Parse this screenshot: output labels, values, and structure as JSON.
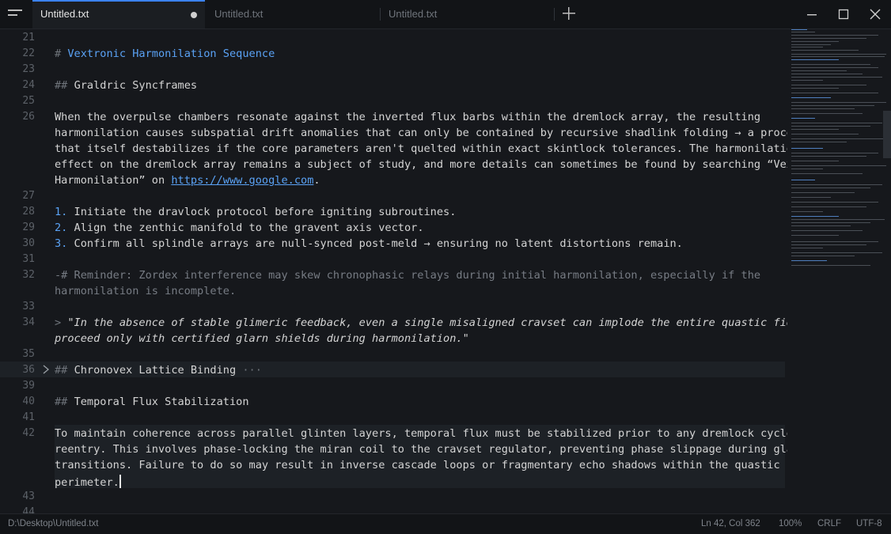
{
  "tabs": [
    {
      "label": "Untitled.txt",
      "active": true,
      "modified": true
    },
    {
      "label": "Untitled.txt",
      "active": false
    },
    {
      "label": "Untitled.txt",
      "active": false
    }
  ],
  "editor": {
    "gutter": [
      "21",
      "22",
      "23",
      "24",
      "25",
      "26",
      "27",
      "28",
      "29",
      "30",
      "31",
      "32",
      "33",
      "34",
      "35",
      "36",
      "39",
      "40",
      "41",
      "42",
      "43",
      "44"
    ],
    "h1_marker": "#",
    "h1_text": "Vextronic Harmonilation Sequence",
    "h2_marker": "##",
    "h2_graldric": "Graldric Syncframes",
    "para1": [
      "When the overpulse chambers resonate against the inverted flux barbs within the dremlock array, the resulting",
      "harmonilation causes subspatial drift anomalies that can only be contained by recursive shadlink folding → a process",
      "that itself destabilizes if the core parameters aren't quelted within exact skintlock tolerances. The harmonilation",
      "effect on the dremlock array remains a subject of study, and more details can sometimes be found by searching “Vextronic"
    ],
    "para1_last_prefix": "Harmonilation” on ",
    "para1_link": "https://www.google.com",
    "para1_last_suffix": ".",
    "list": [
      {
        "num": "1.",
        "text": " Initiate the dravlock protocol before igniting subroutines."
      },
      {
        "num": "2.",
        "text": " Align the zenthic manifold to the gravent axis vector."
      },
      {
        "num": "3.",
        "text": " Confirm all splindle arrays are null-synced post-meld → ensuring no latent distortions remain."
      }
    ],
    "comment": [
      "-# Reminder: Zordex interference may skew chronophasic relays during initial harmonilation, especially if the",
      "harmonilation is incomplete."
    ],
    "quote_marker": ">",
    "quote": [
      " \"In the absence of stable glimeric feedback, even a single misaligned cravset can implode the entire quastic field —",
      "proceed only with certified glarn shields during harmonilation.\""
    ],
    "folded_heading": "Chronovex Lattice Binding",
    "fold_ellipsis": "···",
    "h2_temporal": "Temporal Flux Stabilization",
    "para2": [
      "To maintain coherence across parallel glinten layers, temporal flux must be stabilized prior to any dremlock cycle",
      "reentry. This involves phase-locking the miran coil to the cravset regulator, preventing phase slippage during glarn",
      "transitions. Failure to do so may result in inverse cascade loops or fragmentary echo shadows within the quastic field",
      "perimeter."
    ]
  },
  "status": {
    "path": "D:\\Desktop\\Untitled.txt",
    "position": "Ln 42, Col 362",
    "zoom": "100%",
    "eol": "CRLF",
    "encoding": "UTF-8"
  },
  "colors": {
    "accent": "#3b82f6",
    "heading": "#5aa2f5",
    "background": "#16181c"
  }
}
